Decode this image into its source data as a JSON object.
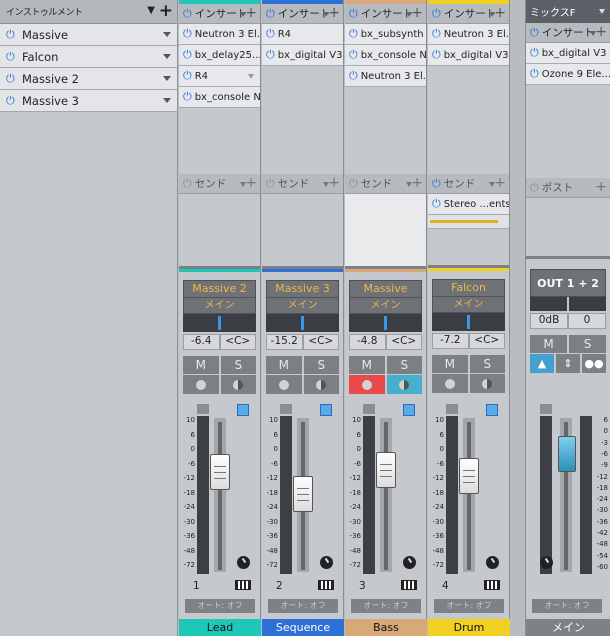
{
  "instruments": {
    "header": "インストゥルメント",
    "items": [
      "Massive",
      "Falcon",
      "Massive 2",
      "Massive 3"
    ]
  },
  "labels": {
    "insert": "インサート",
    "send": "センド",
    "post": "ポスト",
    "auto": "オート: オフ",
    "mute": "M",
    "solo": "S",
    "center": "<C>"
  },
  "channels": [
    {
      "name": "Massive 2",
      "output": "メイン",
      "volume": "-6.4",
      "pan": "<C>",
      "number": "1",
      "label": "Lead",
      "color": "#1ec8b8",
      "inserts": [
        "Neutron 3 El...",
        "bx_delay25...",
        "R4",
        "bx_console N"
      ],
      "sends": []
    },
    {
      "name": "Massive 3",
      "output": "メイン",
      "volume": "-15.2",
      "pan": "<C>",
      "number": "2",
      "label": "Sequence",
      "color": "#2f6fd8",
      "inserts": [
        "R4",
        "bx_digital V3"
      ],
      "sends": []
    },
    {
      "name": "Massive",
      "output": "メイン",
      "volume": "-4.8",
      "pan": "<C>",
      "number": "3",
      "label": "Bass",
      "color": "#d8a878",
      "inserts": [
        "bx_subsynth",
        "bx_console N",
        "Neutron 3 El..."
      ],
      "sends": []
    },
    {
      "name": "Falcon",
      "output": "メイン",
      "volume": "-7.2",
      "pan": "<C>",
      "number": "4",
      "label": "Drum",
      "color": "#f0d020",
      "inserts": [
        "Neutron 3 El...",
        "bx_digital V3"
      ],
      "sends": [
        "Stereo ...ents"
      ]
    }
  ],
  "main": {
    "header": "ミックスF",
    "inserts": [
      "bx_digital V3",
      "Ozone 9 Ele..."
    ],
    "output": "OUT 1 + 2",
    "volume": "0dB",
    "volume2": "0",
    "label": "メイン",
    "mute": "M",
    "solo": "S"
  },
  "scale": [
    "10",
    "6",
    "0",
    "-6",
    "-12",
    "-18",
    "-24",
    "-30",
    "-36",
    "-48",
    "-72"
  ],
  "main_scale": [
    "6",
    "0",
    "-3",
    "-6",
    "-9",
    "-12",
    "-18",
    "-24",
    "-30",
    "-36",
    "-42",
    "-48",
    "-54",
    "-60"
  ]
}
